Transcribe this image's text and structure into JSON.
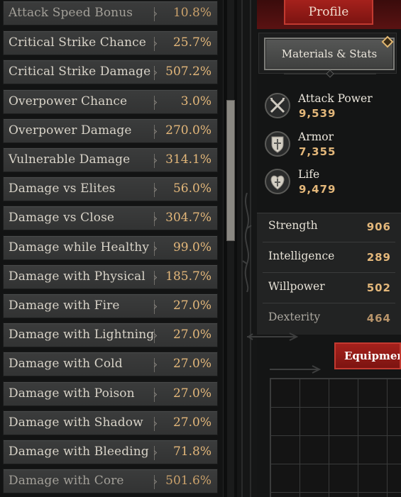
{
  "stats": [
    {
      "label": "Attack Speed Bonus",
      "value": "10.8%",
      "faded": true
    },
    {
      "label": "Critical Strike Chance",
      "value": "25.7%"
    },
    {
      "label": "Critical Strike Damage",
      "value": "507.2%"
    },
    {
      "label": "Overpower Chance",
      "value": "3.0%"
    },
    {
      "label": "Overpower Damage",
      "value": "270.0%"
    },
    {
      "label": "Vulnerable Damage",
      "value": "314.1%"
    },
    {
      "label": "Damage vs Elites",
      "value": "56.0%"
    },
    {
      "label": "Damage vs Close",
      "value": "304.7%"
    },
    {
      "label": "Damage while Healthy",
      "value": "99.0%"
    },
    {
      "label": "Damage with Physical",
      "value": "185.7%"
    },
    {
      "label": "Damage with Fire",
      "value": "27.0%"
    },
    {
      "label": "Damage with Lightning",
      "value": "27.0%"
    },
    {
      "label": "Damage with Cold",
      "value": "27.0%"
    },
    {
      "label": "Damage with Poison",
      "value": "27.0%"
    },
    {
      "label": "Damage with Shadow",
      "value": "27.0%"
    },
    {
      "label": "Damage with Bleeding",
      "value": "71.8%"
    },
    {
      "label": "Damage with Core",
      "value": "501.6%",
      "faded": true
    }
  ],
  "profile": {
    "label": "Profile"
  },
  "materials": {
    "label": "Materials & Stats"
  },
  "core_stats": [
    {
      "name": "Attack Power",
      "value": "9,539",
      "icon": "crossed-swords-icon"
    },
    {
      "name": "Armor",
      "value": "7,355",
      "icon": "shield-icon"
    },
    {
      "name": "Life",
      "value": "9,479",
      "icon": "heart-icon"
    }
  ],
  "attributes": [
    {
      "label": "Strength",
      "value": "906"
    },
    {
      "label": "Intelligence",
      "value": "289"
    },
    {
      "label": "Willpower",
      "value": "502"
    },
    {
      "label": "Dexterity",
      "value": "464",
      "faded": true
    }
  ],
  "equipment": {
    "label": "Equipment"
  },
  "scroll": {
    "position": 0.2,
    "visible_fraction": 0.28
  },
  "colors": {
    "accent_gold": "#e3b77a",
    "accent_red": "#a5211c"
  }
}
